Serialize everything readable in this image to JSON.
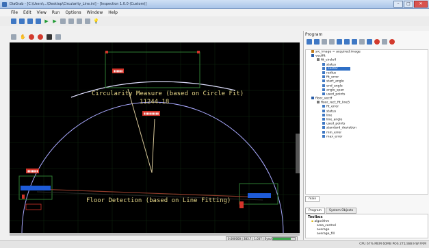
{
  "window": {
    "title": "DiaGrab - [C:\\Users\\...\\Desktop\\Circularity_Line.ini] - [Inspection 1.0.0 (Custom)]",
    "buttons": [
      "–",
      "□",
      "✕"
    ]
  },
  "menu": [
    "File",
    "Edit",
    "View",
    "Run",
    "Options",
    "Window",
    "Help"
  ],
  "canvas": {
    "circularity_text": "Circularity Measure (based on Circle Fit)",
    "circularity_value": "11244.18",
    "floor_text": "Floor Detection (based on Line Fitting)",
    "status_mini": "0.000000 | 383.7 | 1.037 | SyncCal_1.0 | 100%",
    "progress": 0.82,
    "colors": {
      "overlay_text": "#e8d98a",
      "roi_box": "#2e7d32",
      "fit_line": "#1e5bd8",
      "label_tag": "#d4342a"
    }
  },
  "program_panel": {
    "header": "Program",
    "tree": [
      {
        "indent": 1,
        "icon": "var",
        "label": "src_image = acquired.image"
      },
      {
        "indent": 1,
        "icon": "node",
        "label": "vectfit"
      },
      {
        "indent": 2,
        "icon": "expand",
        "label": "fit_circle4"
      },
      {
        "indent": 3,
        "icon": "out",
        "label": "status"
      },
      {
        "indent": 3,
        "icon": "out",
        "label": "center",
        "selected": true
      },
      {
        "indent": 3,
        "icon": "out",
        "label": "radius"
      },
      {
        "indent": 3,
        "icon": "out",
        "label": "fit_error"
      },
      {
        "indent": 3,
        "icon": "out",
        "label": "start_angle"
      },
      {
        "indent": 3,
        "icon": "out",
        "label": "end_angle"
      },
      {
        "indent": 3,
        "icon": "out",
        "label": "angle_span"
      },
      {
        "indent": 3,
        "icon": "out",
        "label": "used_points"
      },
      {
        "indent": 1,
        "icon": "node",
        "label": "floor_vectf"
      },
      {
        "indent": 2,
        "icon": "expand",
        "label": "floor_rect_fit_line5"
      },
      {
        "indent": 3,
        "icon": "out",
        "label": "fit_error"
      },
      {
        "indent": 3,
        "icon": "out",
        "label": "status"
      },
      {
        "indent": 3,
        "icon": "out",
        "label": "line"
      },
      {
        "indent": 3,
        "icon": "out",
        "label": "line_angle"
      },
      {
        "indent": 3,
        "icon": "out",
        "label": "used_points"
      },
      {
        "indent": 3,
        "icon": "out",
        "label": "standard_deviation"
      },
      {
        "indent": 3,
        "icon": "out",
        "label": "min_error"
      },
      {
        "indent": 3,
        "icon": "out",
        "label": "max_error"
      }
    ],
    "tab_main": "main",
    "tabs": [
      "Program",
      "System Objects"
    ],
    "toolbox_header": "Toolbox",
    "toolbox_items": [
      "algorithm",
      "area_control",
      "average",
      "average_fill"
    ]
  },
  "statusbar": {
    "info": "CPU 67% MEM 60MB POS 271/388  HW FRM"
  }
}
